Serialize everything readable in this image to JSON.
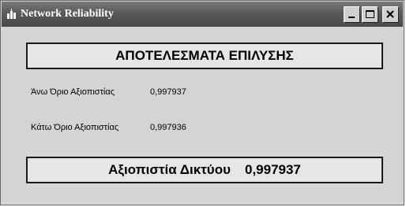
{
  "window": {
    "title": "Network Reliability",
    "icon": "app-icon",
    "controls": {
      "minimize": "minimize-icon",
      "maximize": "maximize-icon",
      "close": "close-icon"
    }
  },
  "heading": "ΑΠΟΤΕΛΕΣΜΑΤΑ ΕΠΙΛΥΣΗΣ",
  "results": {
    "upper_label": "Άνω Όριο Αξιοπιστίας",
    "upper_value": "0,997937",
    "lower_label": "Κάτω Όριο Αξιοπιστίας",
    "lower_value": "0,997936"
  },
  "network": {
    "label": "Αξιοπιστία Δικτύου",
    "value": "0,997937"
  }
}
